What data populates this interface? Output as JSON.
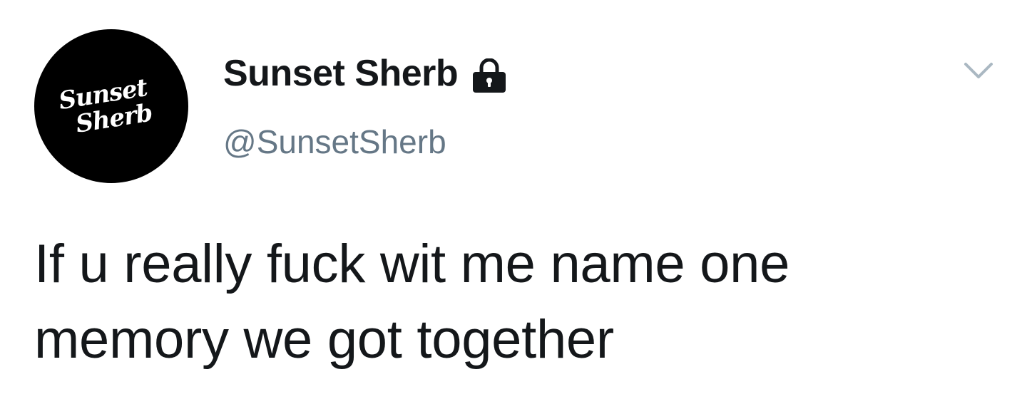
{
  "tweet": {
    "avatar": {
      "logo_line1": "Sunset",
      "logo_line2": "Sherb",
      "background_color": "#000000"
    },
    "display_name": "Sunset Sherb",
    "protected_icon": "lock-icon",
    "handle": "@SunsetSherb",
    "menu_icon": "chevron-down-icon",
    "text": "If u really fuck wit me name one memory we got together",
    "colors": {
      "name": "#14171a",
      "handle": "#657786",
      "chevron": "#aab8c2"
    }
  }
}
